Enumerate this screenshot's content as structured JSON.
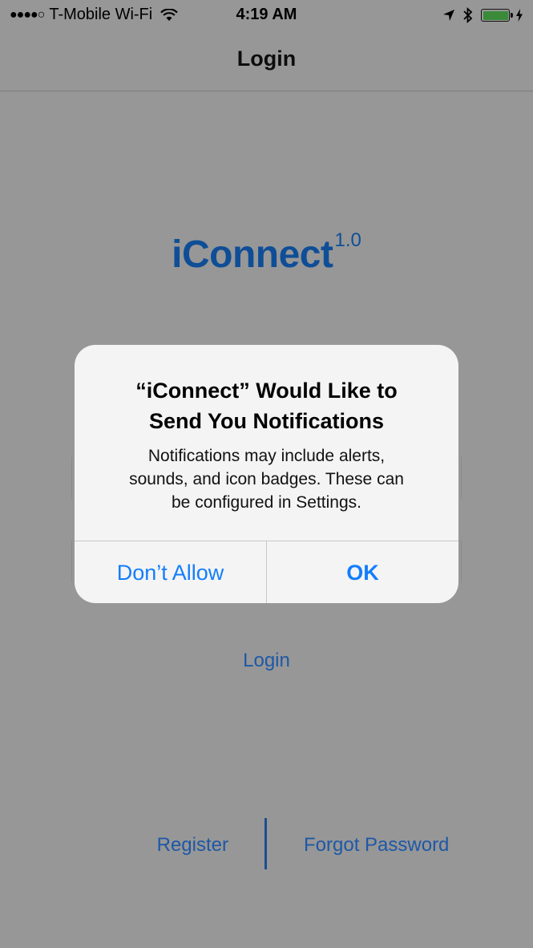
{
  "status_bar": {
    "signal": "●●●●○",
    "carrier": "T-Mobile Wi-Fi",
    "time": "4:19 AM",
    "icons": [
      "signal-dots-icon",
      "wifi-icon",
      "location-arrow-icon",
      "bluetooth-icon",
      "battery-charging-icon"
    ],
    "battery_color": "#3a8a3a"
  },
  "nav": {
    "title": "Login"
  },
  "logo": {
    "name": "iConnect",
    "version": "1.0",
    "color": "#0f4e97"
  },
  "links": {
    "login": "Login",
    "register": "Register",
    "forgot_password": "Forgot Password",
    "color": "#1e58a6"
  },
  "alert": {
    "title_line1": "“iConnect” Would Like to",
    "title_line2": "Send You Notifications",
    "message_line1": "Notifications may include alerts,",
    "message_line2": "sounds, and icon badges. These can",
    "message_line3": "be configured in Settings.",
    "dont_allow": "Don’t Allow",
    "ok": "OK",
    "button_color": "#147efb"
  }
}
